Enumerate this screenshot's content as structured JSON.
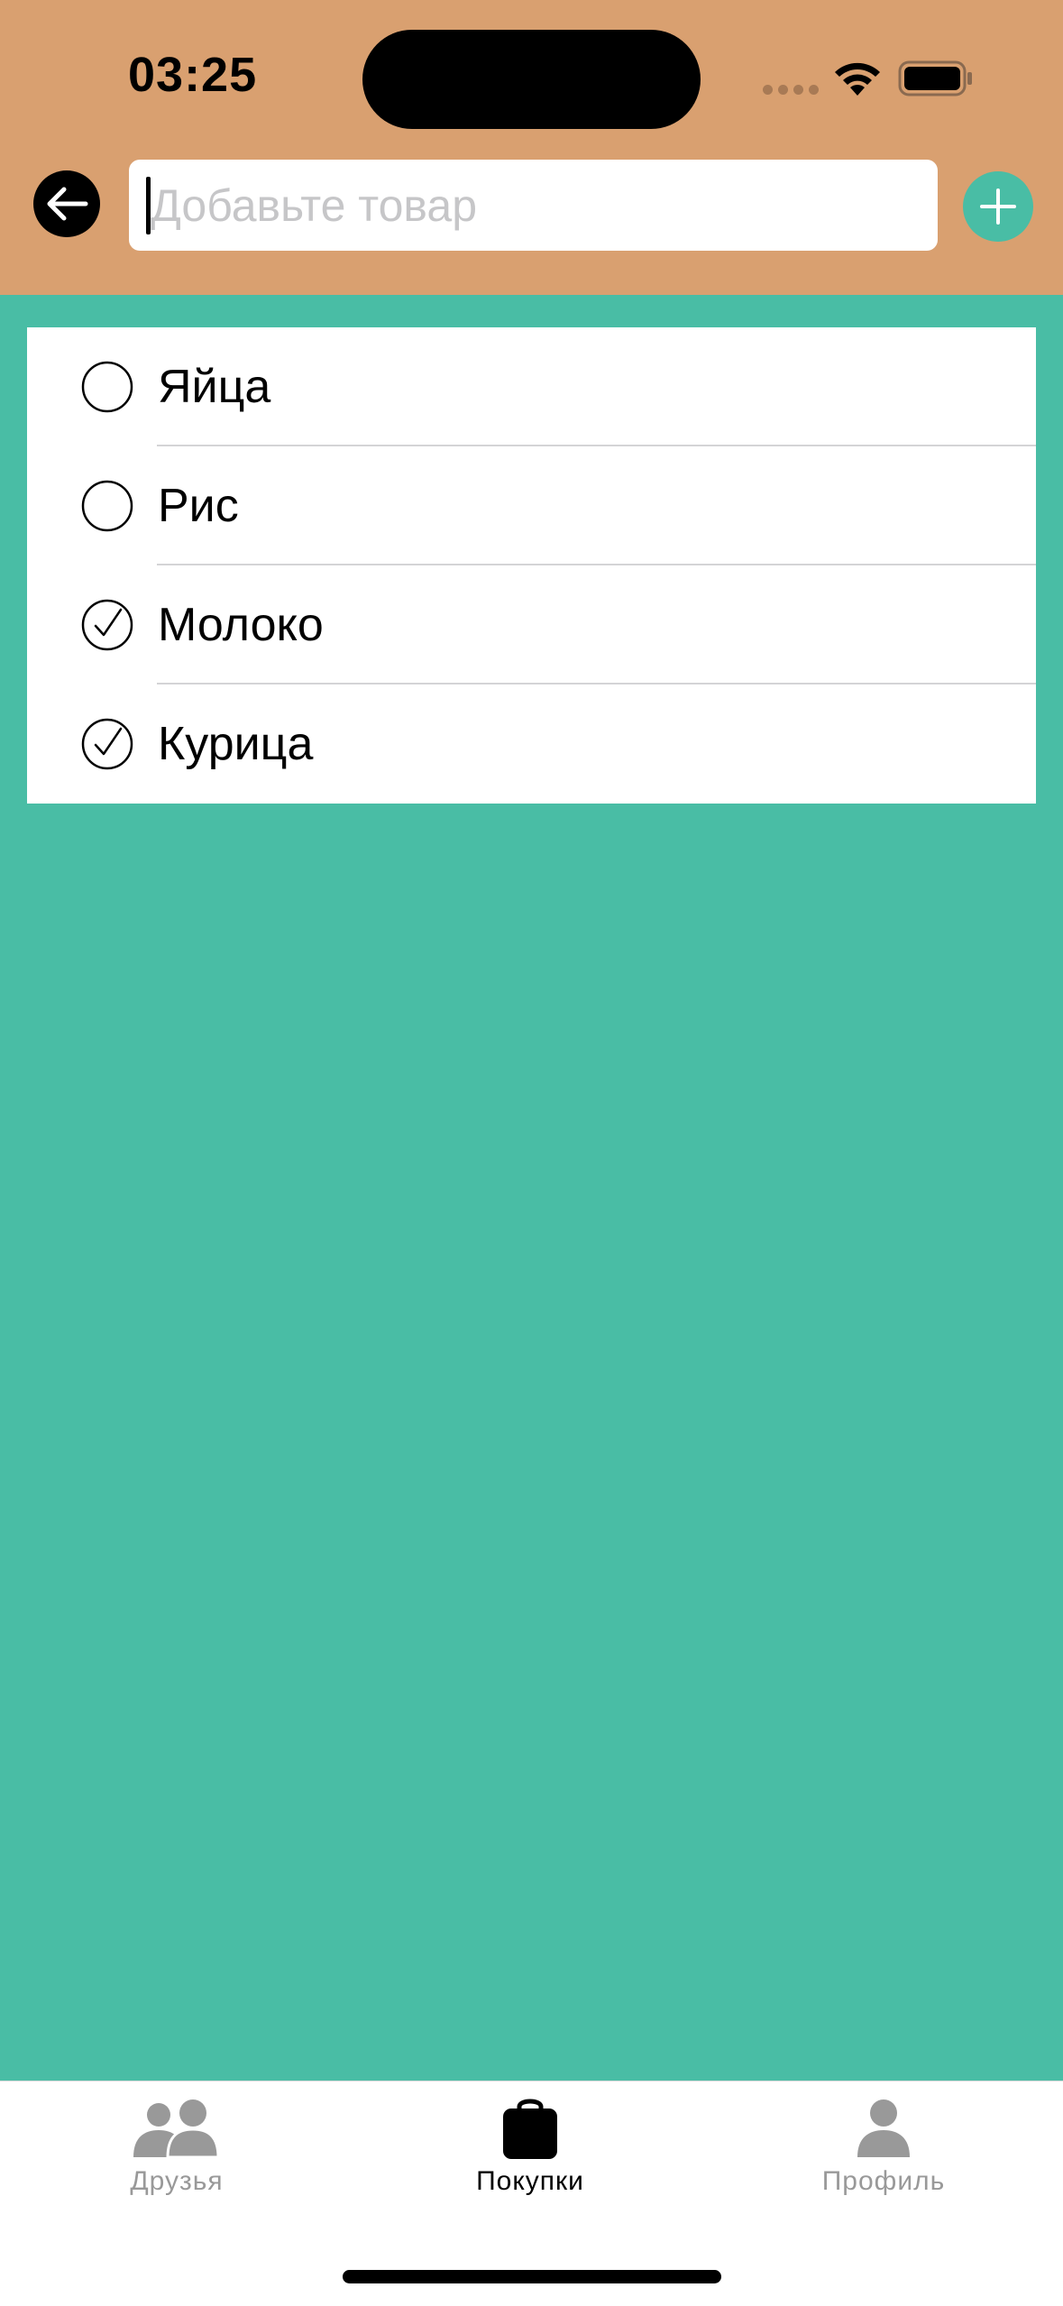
{
  "status_bar": {
    "time": "03:25"
  },
  "header": {
    "search_placeholder": "Добавьте товар",
    "search_value": "",
    "icons": {
      "back": "arrow-left-icon",
      "add": "plus-icon"
    }
  },
  "shopping_list": {
    "items": [
      {
        "label": "Яйца",
        "checked": false
      },
      {
        "label": "Рис",
        "checked": false
      },
      {
        "label": "Молоко",
        "checked": true
      },
      {
        "label": "Курица",
        "checked": true
      }
    ]
  },
  "tab_bar": {
    "tabs": [
      {
        "label": "Друзья",
        "icon": "people-icon",
        "active": false
      },
      {
        "label": "Покупки",
        "icon": "shopping-bag-icon",
        "active": true
      },
      {
        "label": "Профиль",
        "icon": "person-icon",
        "active": false
      }
    ]
  },
  "colors": {
    "header_background": "#d9a070",
    "content_background": "#49bda5",
    "accent": "#49bda5",
    "inactive_tab": "#999999",
    "active_tab": "#000000"
  }
}
